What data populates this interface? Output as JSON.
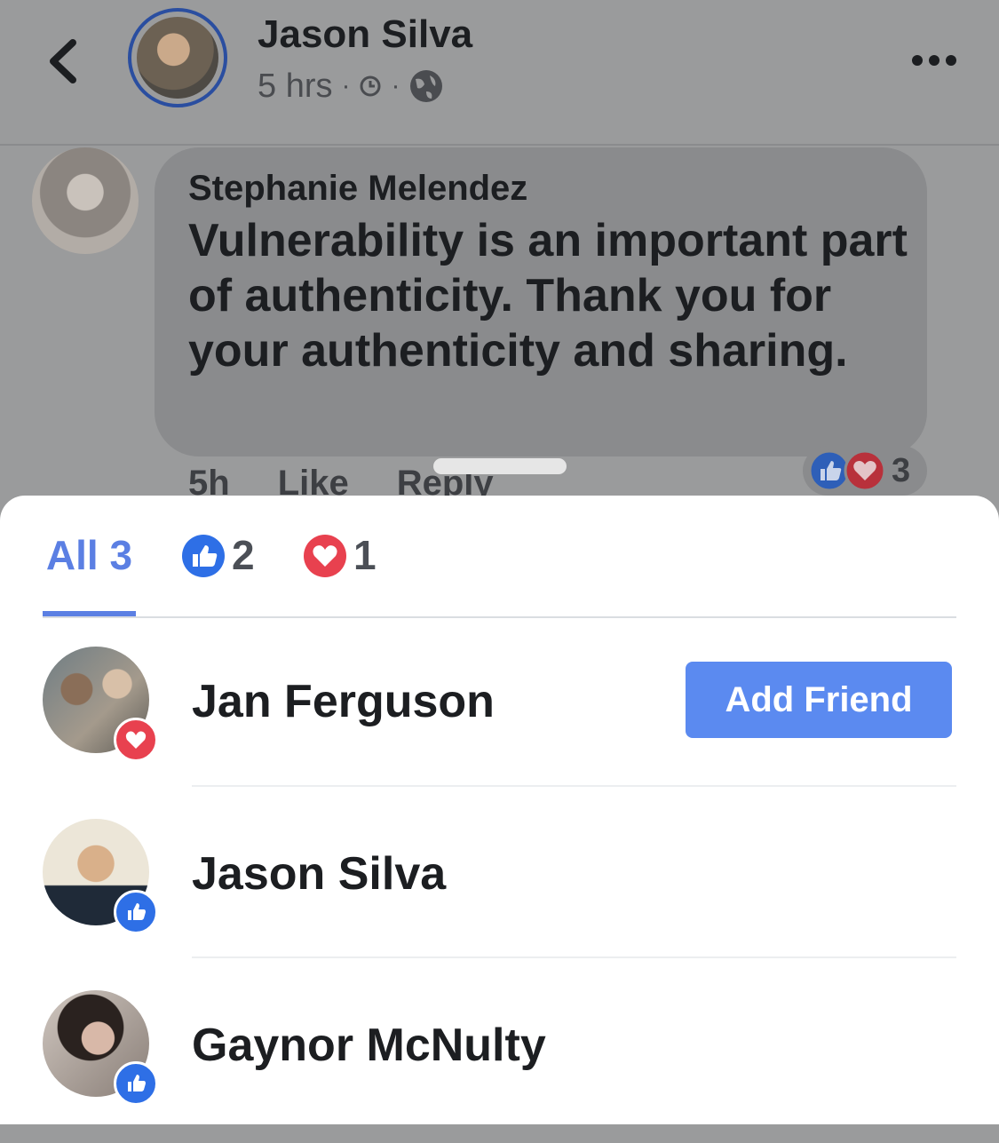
{
  "header": {
    "poster_name": "Jason Silva",
    "time": "5 hrs",
    "sep": "·"
  },
  "comment": {
    "author": "Stephanie Melendez",
    "text": "Vulnerability is an important part of authenticity. Thank you for your authenticity and sharing.",
    "time": "5h",
    "like_label": "Like",
    "reply_label": "Reply",
    "reaction_count": "3"
  },
  "tabs": [
    {
      "label": "All 3"
    },
    {
      "label": "2",
      "icon": "like-icon"
    },
    {
      "label": "1",
      "icon": "love-icon"
    }
  ],
  "people": [
    {
      "name": "Jan Ferguson",
      "reaction": "love",
      "action": "Add Friend"
    },
    {
      "name": "Jason Silva",
      "reaction": "like"
    },
    {
      "name": "Gaynor McNulty",
      "reaction": "like"
    }
  ],
  "colors": {
    "accent": "#5b7fe3",
    "like": "#2e6fe6",
    "love": "#e8414f",
    "add_friend_bg": "#5b8af0"
  }
}
